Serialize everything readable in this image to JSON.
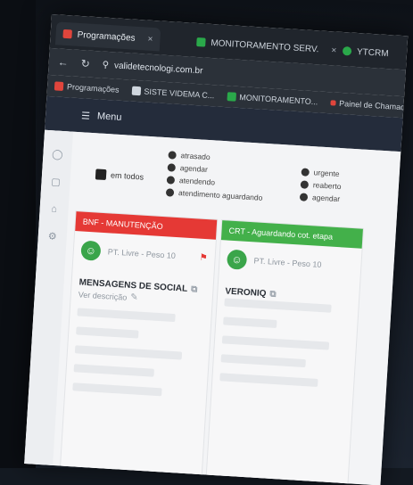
{
  "tabs": [
    {
      "label": "Programações",
      "close": "×",
      "active": true
    },
    {
      "label": "MONITORAMENTO SERV.",
      "close": "×",
      "active": false
    },
    {
      "label": "YTCRM",
      "close": "",
      "active": false
    }
  ],
  "toolbar": {
    "back": "←",
    "reload": "↻",
    "url": "validetecnologi.com.br"
  },
  "bookmarks": [
    {
      "label": "Programações"
    },
    {
      "label": "SISTE VIDEMA C..."
    },
    {
      "label": "MONITORAMENTO..."
    },
    {
      "label": "Painel de Chamad..."
    }
  ],
  "header": {
    "menu_icon": "☰",
    "menu_label": "Menu"
  },
  "legend": {
    "chip_label": "em todos",
    "list_left": [
      "atrasado",
      "agendar",
      "atendendo",
      "atendimento aguardando"
    ],
    "list_right": [
      "urgente",
      "reaberto",
      "agendar"
    ]
  },
  "columns": [
    {
      "header": "BNF - MANUTENÇÃO",
      "avatar": "☺",
      "meta": "PT. Livre - Peso 10",
      "title": "MENSAGENS DE SOCIAL",
      "subtitle": "Ver descrição"
    },
    {
      "header": "CRT - Aguardando cot. etapa",
      "avatar": "☺",
      "meta": "PT. Livre - Peso 10",
      "title": "VERONIQ",
      "subtitle": ""
    }
  ]
}
